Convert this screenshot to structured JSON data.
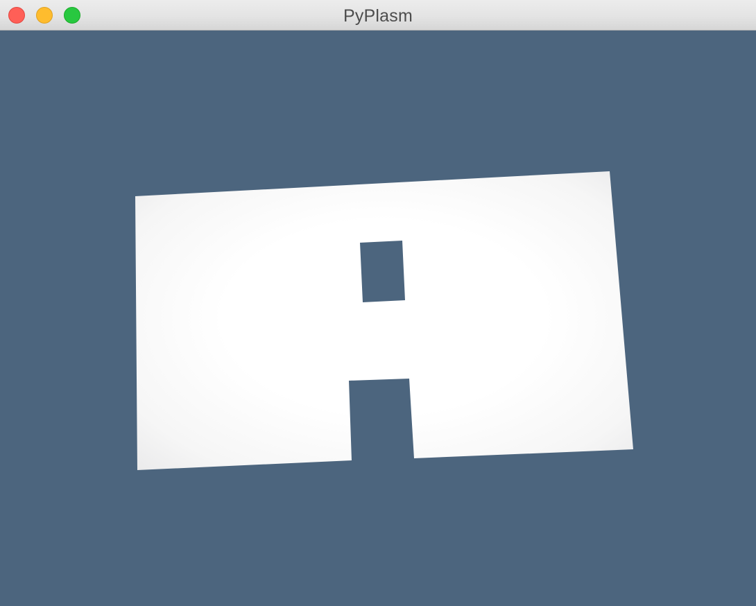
{
  "window": {
    "title": "PyPlasm",
    "buttons": {
      "close": {
        "name": "close",
        "color": "#ff5f57",
        "border": "#e2463f"
      },
      "minimize": {
        "name": "minimize",
        "color": "#febc2e",
        "border": "#dea123"
      },
      "zoom": {
        "name": "zoom",
        "color": "#28c840",
        "border": "#1aab29"
      }
    }
  },
  "viewport": {
    "background": "#4c657e",
    "model": {
      "description_color": "#ffffff",
      "shade_color": "#e9e9ea"
    }
  }
}
